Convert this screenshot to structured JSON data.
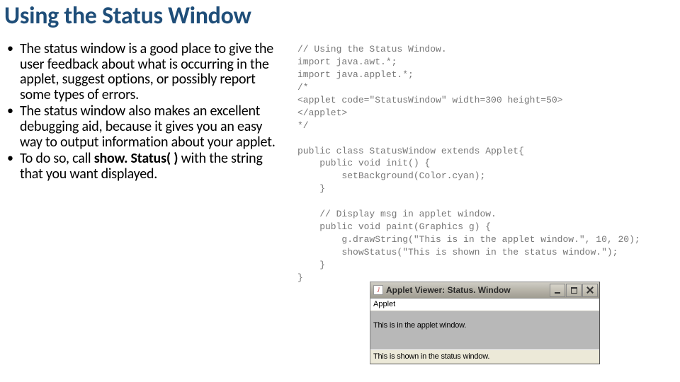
{
  "slide": {
    "title": "Using the Status Window",
    "bullets": [
      "The status window is a good place to give the user feedback about what is occurring in the applet, suggest options, or possibly report some types of errors.",
      "The status window also makes an excellent debugging aid, because it gives you an easy way to output information about your applet.",
      {
        "pre": "To do so, call ",
        "bold": "show. Status( )",
        "post": " with the string that you want displayed."
      }
    ]
  },
  "code": "// Using the Status Window.\nimport java.awt.*;\nimport java.applet.*;\n/*\n<applet code=\"StatusWindow\" width=300 height=50>\n</applet>\n*/\n\npublic class StatusWindow extends Applet{\n    public void init() {\n        setBackground(Color.cyan);\n    }\n\n    // Display msg in applet window.\n    public void paint(Graphics g) {\n        g.drawString(\"This is in the applet window.\", 10, 20);\n        showStatus(\"This is shown in the status window.\");\n    }\n}",
  "applet_window": {
    "title": "Applet Viewer: Status. Window",
    "menu": "Applet",
    "canvas_text": "This is in the applet window.",
    "status_text": "This is shown in the status window.",
    "java_icon": "J"
  }
}
